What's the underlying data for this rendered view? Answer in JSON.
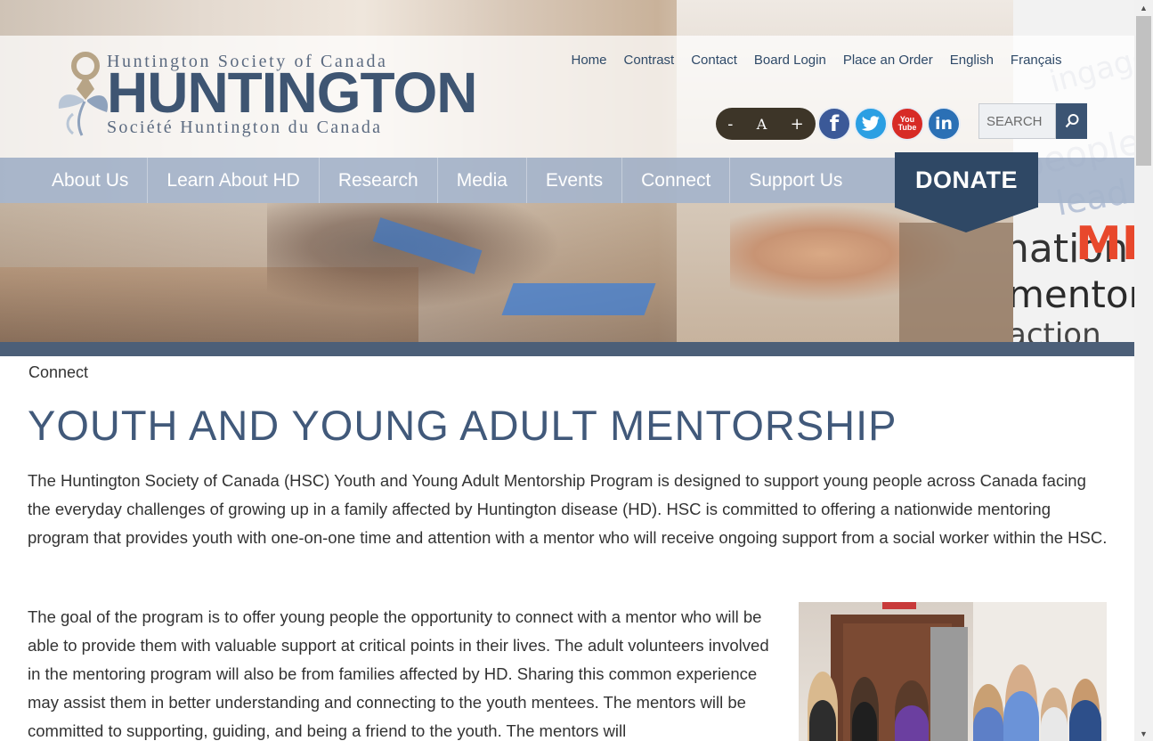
{
  "org": {
    "name_en": "Huntington Society of Canada",
    "wordmark": "HUNTINGTON",
    "name_fr": "Société Huntington du Canada"
  },
  "top_links": [
    "Home",
    "Contrast",
    "Contact",
    "Board Login",
    "Place an Order",
    "English",
    "Français"
  ],
  "font_controls": {
    "decrease": "-",
    "reset": "A",
    "increase": "+"
  },
  "social": [
    {
      "name": "facebook-icon",
      "glyph": "f"
    },
    {
      "name": "twitter-icon",
      "glyph": ""
    },
    {
      "name": "youtube-icon",
      "glyph": "You Tube"
    },
    {
      "name": "linkedin-icon",
      "glyph": "in"
    }
  ],
  "search": {
    "placeholder": "SEARCH"
  },
  "nav": {
    "items": [
      "About Us",
      "Learn About HD",
      "Research",
      "Media",
      "Events",
      "Connect",
      "Support Us"
    ],
    "donate": "DONATE"
  },
  "hero_words": [
    "ingage",
    "people",
    "lead",
    "nation",
    "ME",
    "mentor",
    "action"
  ],
  "breadcrumb": "Connect",
  "page_title": "YOUTH AND YOUNG ADULT MENTORSHIP",
  "intro": "The Huntington Society of Canada (HSC) Youth and Young Adult Mentorship Program is designed to support young people across Canada facing the everyday challenges of growing up in a family affected by Huntington disease (HD). HSC is committed to offering a nationwide mentoring program that provides youth with one-on-one time and attention with a mentor who will receive ongoing support from a social worker within the HSC.",
  "goal": "The goal of the program is to offer young people the opportunity to connect with a mentor who will be able to provide them with valuable support at critical points in their lives. The adult volunteers involved in the mentoring program will also be from families affected by HD. Sharing this common experience may assist them in better understanding and connecting to the youth mentees. The mentors will be committed to supporting, guiding, and being a friend to the youth. The mentors will",
  "colors": {
    "brand_navy": "#2f4865",
    "title_blue": "#41597a",
    "nav_bar": "#a5b4cb"
  }
}
